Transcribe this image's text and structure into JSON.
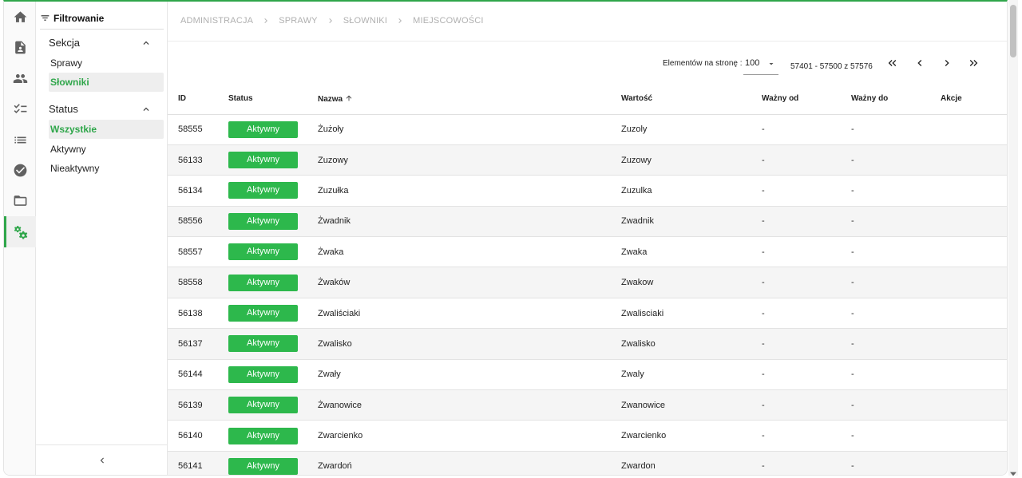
{
  "colors": {
    "accent": "#2fa64a",
    "badge": "#2db84c"
  },
  "rail": [
    {
      "icon": "home-icon"
    },
    {
      "icon": "document-icon"
    },
    {
      "icon": "users-icon"
    },
    {
      "icon": "checklist-icon"
    },
    {
      "icon": "list-icon"
    },
    {
      "icon": "check-circle-icon"
    },
    {
      "icon": "folder-icon"
    },
    {
      "icon": "settings-icon",
      "active": true
    }
  ],
  "filters": {
    "title": "Filtrowanie",
    "section1": {
      "title": "Sekcja",
      "items": [
        "Sprawy",
        "Słowniki"
      ],
      "selected": "Słowniki"
    },
    "section2": {
      "title": "Status",
      "items": [
        "Wszystkie",
        "Aktywny",
        "Nieaktywny"
      ],
      "selected": "Wszystkie"
    }
  },
  "breadcrumb": [
    "ADMINISTRACJA",
    "SPRAWY",
    "SŁOWNIKI",
    "MIEJSCOWOŚCI"
  ],
  "pager": {
    "label": "Elementów na stronę :",
    "page_size": "100",
    "range": "57401 - 57500 z 57576"
  },
  "table": {
    "columns": [
      "ID",
      "Status",
      "Nazwa",
      "Wartość",
      "Ważny od",
      "Ważny do",
      "Akcje"
    ],
    "sort_column": "Nazwa",
    "rows": [
      {
        "id": "58555",
        "status": "Aktywny",
        "name": "Żużoły",
        "value": "Zuzoly",
        "from": "-",
        "to": "-"
      },
      {
        "id": "56133",
        "status": "Aktywny",
        "name": "Zuzowy",
        "value": "Zuzowy",
        "from": "-",
        "to": "-"
      },
      {
        "id": "56134",
        "status": "Aktywny",
        "name": "Zuzułka",
        "value": "Zuzulka",
        "from": "-",
        "to": "-"
      },
      {
        "id": "58556",
        "status": "Aktywny",
        "name": "Żwadnik",
        "value": "Zwadnik",
        "from": "-",
        "to": "-"
      },
      {
        "id": "58557",
        "status": "Aktywny",
        "name": "Żwaka",
        "value": "Zwaka",
        "from": "-",
        "to": "-"
      },
      {
        "id": "58558",
        "status": "Aktywny",
        "name": "Żwaków",
        "value": "Zwakow",
        "from": "-",
        "to": "-"
      },
      {
        "id": "56138",
        "status": "Aktywny",
        "name": "Zwaliściaki",
        "value": "Zwalisciaki",
        "from": "-",
        "to": "-"
      },
      {
        "id": "56137",
        "status": "Aktywny",
        "name": "Zwalisko",
        "value": "Zwalisko",
        "from": "-",
        "to": "-"
      },
      {
        "id": "56144",
        "status": "Aktywny",
        "name": "Zwały",
        "value": "Zwaly",
        "from": "-",
        "to": "-"
      },
      {
        "id": "56139",
        "status": "Aktywny",
        "name": "Żwanowice",
        "value": "Zwanowice",
        "from": "-",
        "to": "-"
      },
      {
        "id": "56140",
        "status": "Aktywny",
        "name": "Zwarcienko",
        "value": "Zwarcienko",
        "from": "-",
        "to": "-"
      },
      {
        "id": "56141",
        "status": "Aktywny",
        "name": "Zwardoń",
        "value": "Zwardon",
        "from": "-",
        "to": "-"
      }
    ]
  }
}
